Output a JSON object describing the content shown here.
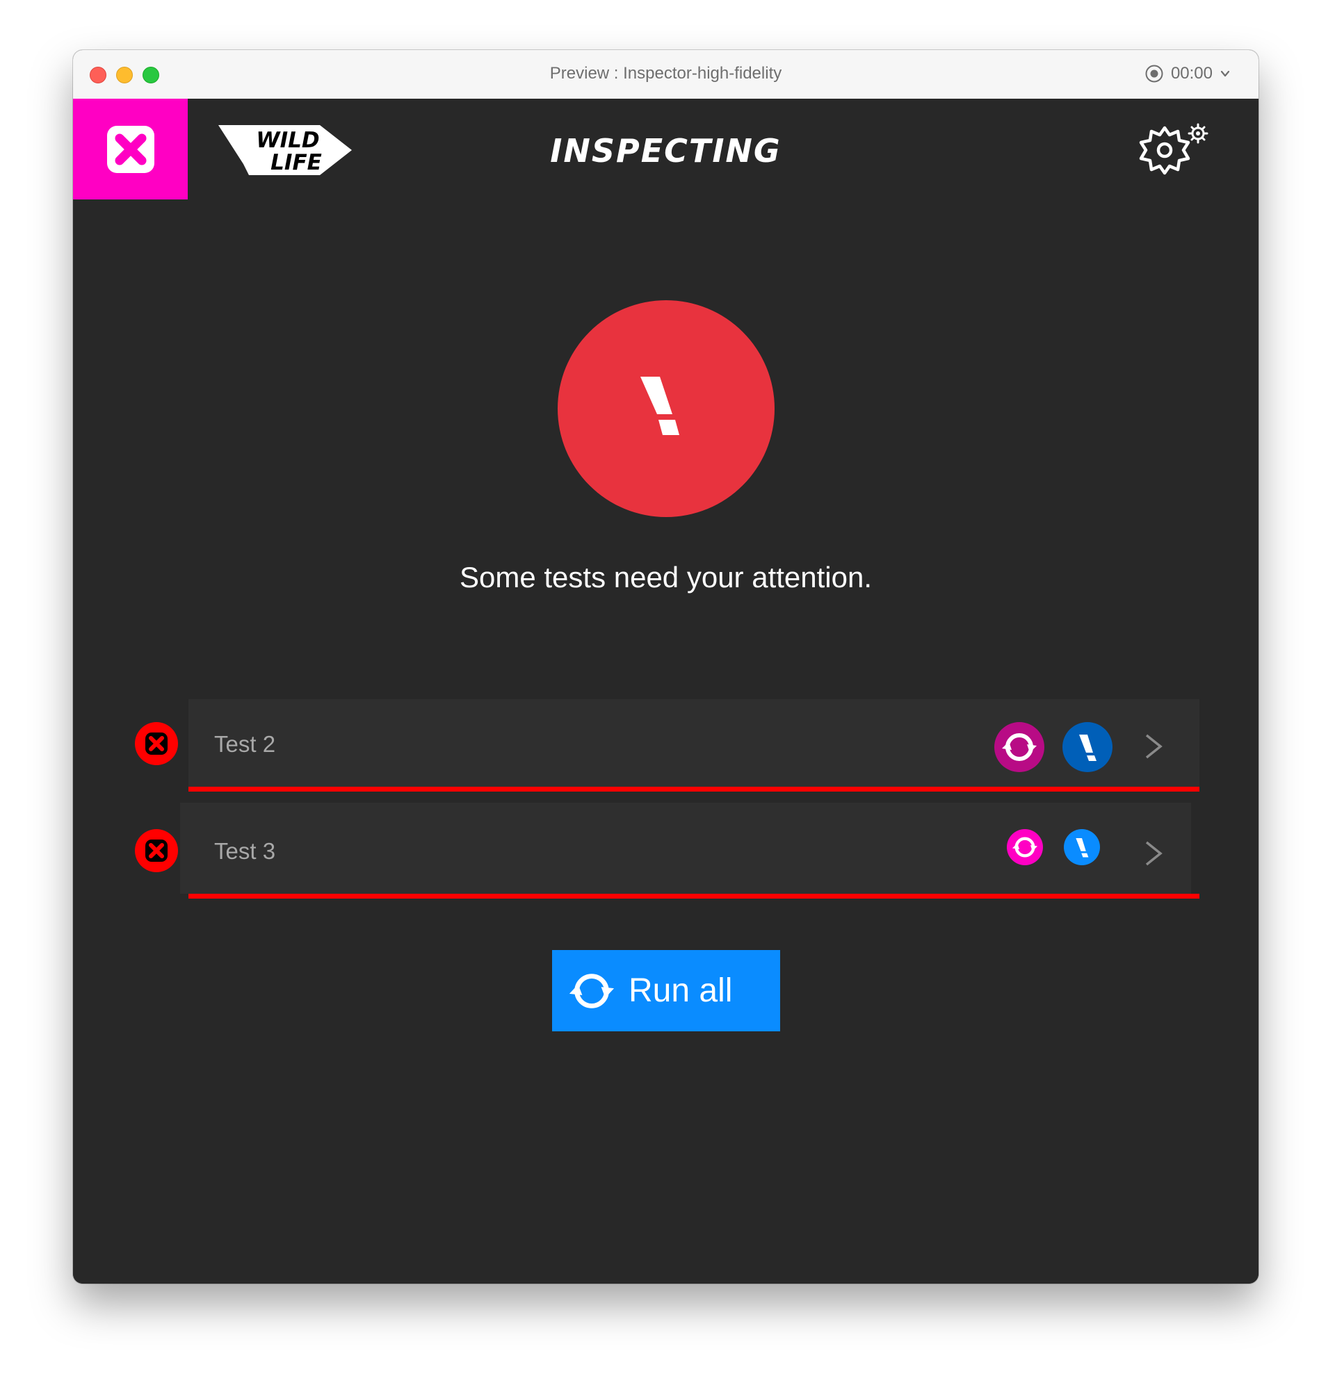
{
  "window": {
    "title": "Preview : Inspector-high-fidelity",
    "timer": "00:00"
  },
  "header": {
    "title": "INSPECTING",
    "logo_icon": "wildlife-logo",
    "close_icon": "close-x-icon",
    "settings_icon": "settings-gear-icon"
  },
  "status": {
    "message": "Some tests need your attention.",
    "icon": "alert-exclamation-icon"
  },
  "tests": [
    {
      "label": "Test 2",
      "status": "failed"
    },
    {
      "label": "Test 3",
      "status": "failed"
    }
  ],
  "actions": {
    "run_all_label": "Run all"
  },
  "colors": {
    "accent_pink": "#ff00c3",
    "accent_blue": "#0a8cff",
    "error_red": "#ff0000",
    "alert_red": "#e8333e",
    "background": "#282828"
  }
}
